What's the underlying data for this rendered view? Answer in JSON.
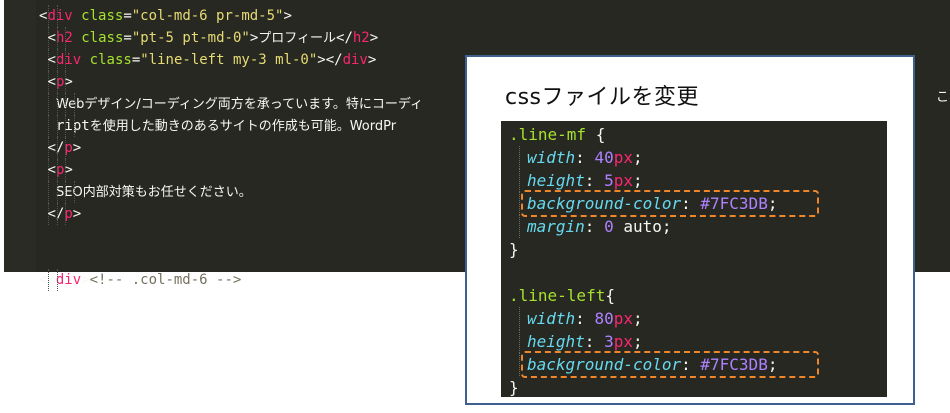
{
  "editor": {
    "lines": [
      {
        "indent": 2,
        "tokens": [
          [
            "t-text",
            "<"
          ],
          [
            "t-tag",
            "div"
          ],
          [
            "t-attr",
            " class"
          ],
          [
            "t-text",
            "="
          ],
          [
            "t-str",
            "\"col-md-6 pr-md-5\""
          ],
          [
            "t-text",
            ">"
          ]
        ]
      },
      {
        "indent": 3,
        "tokens": [
          [
            "t-text",
            "<"
          ],
          [
            "t-tag",
            "h2"
          ],
          [
            "t-attr",
            " class"
          ],
          [
            "t-text",
            "="
          ],
          [
            "t-str",
            "\"pt-5 pt-md-0\""
          ],
          [
            "t-text",
            ">"
          ],
          [
            "t-text jp",
            "プロフィール"
          ],
          [
            "t-text",
            "</"
          ],
          [
            "t-tag",
            "h2"
          ],
          [
            "t-text",
            ">"
          ]
        ]
      },
      {
        "indent": 3,
        "tokens": [
          [
            "t-text",
            "<"
          ],
          [
            "t-tag",
            "div"
          ],
          [
            "t-attr",
            " class"
          ],
          [
            "t-text",
            "="
          ],
          [
            "t-str",
            "\"line-left my-3 ml-0\""
          ],
          [
            "t-text",
            "></"
          ],
          [
            "t-tag",
            "div"
          ],
          [
            "t-text",
            ">"
          ]
        ]
      },
      {
        "indent": 3,
        "tokens": [
          [
            "t-text",
            "<"
          ],
          [
            "t-tag",
            "p"
          ],
          [
            "t-text",
            ">"
          ]
        ]
      },
      {
        "indent": 4,
        "tokens": [
          [
            "t-text jp",
            "Webデザイン/コーディング両方を承っています。特にコーディ"
          ]
        ]
      },
      {
        "indent": 4,
        "tokens": [
          [
            "t-text",
            "ript"
          ],
          [
            "t-text jp",
            "を使用した動きのあるサイトの作成も可能。WordPr"
          ]
        ]
      },
      {
        "indent": 3,
        "tokens": [
          [
            "t-text",
            "</"
          ],
          [
            "t-tag",
            "p"
          ],
          [
            "t-text",
            ">"
          ]
        ]
      },
      {
        "indent": 3,
        "tokens": [
          [
            "t-text",
            "<"
          ],
          [
            "t-tag",
            "p"
          ],
          [
            "t-text",
            ">"
          ]
        ]
      },
      {
        "indent": 4,
        "tokens": [
          [
            "t-text jp",
            "SEO内部対策もお任せください。"
          ]
        ]
      },
      {
        "indent": 3,
        "tokens": [
          [
            "t-text",
            "</"
          ],
          [
            "t-tag",
            "p"
          ],
          [
            "t-text",
            ">"
          ]
        ]
      },
      {
        "indent": 0,
        "tokens": []
      },
      {
        "indent": 0,
        "tokens": []
      },
      {
        "indent": 2,
        "tokens": [
          [
            "t-text",
            "</"
          ],
          [
            "t-tag",
            "div"
          ],
          [
            "t-text",
            ">"
          ],
          [
            "t-com",
            "<!-- .col-md-6 -->"
          ]
        ]
      }
    ],
    "overflow_right": "こと、ま"
  },
  "panel": {
    "title": "cssファイルを変更",
    "lines": [
      {
        "indent": 0,
        "tokens": [
          [
            "t-sel",
            ".line-mf"
          ],
          [
            "t-text",
            " {"
          ]
        ]
      },
      {
        "indent": 1,
        "tokens": [
          [
            "t-prop",
            "width"
          ],
          [
            "t-text",
            ": "
          ],
          [
            "t-num",
            "40"
          ],
          [
            "t-unit",
            "px"
          ],
          [
            "t-text",
            ";"
          ]
        ]
      },
      {
        "indent": 1,
        "tokens": [
          [
            "t-prop",
            "height"
          ],
          [
            "t-text",
            ": "
          ],
          [
            "t-num",
            "5"
          ],
          [
            "t-unit",
            "px"
          ],
          [
            "t-text",
            ";"
          ]
        ]
      },
      {
        "indent": 1,
        "tokens": [
          [
            "t-prop",
            "background-color"
          ],
          [
            "t-text",
            ": "
          ],
          [
            "t-color",
            "#7FC3DB"
          ],
          [
            "t-text",
            ";"
          ]
        ]
      },
      {
        "indent": 1,
        "tokens": [
          [
            "t-prop",
            "margin"
          ],
          [
            "t-text",
            ": "
          ],
          [
            "t-num",
            "0"
          ],
          [
            "t-text",
            " auto;"
          ]
        ]
      },
      {
        "indent": 0,
        "tokens": [
          [
            "t-text",
            "}"
          ]
        ]
      },
      {
        "indent": 0,
        "tokens": []
      },
      {
        "indent": 0,
        "tokens": [
          [
            "t-sel",
            ".line-left"
          ],
          [
            "t-text",
            "{"
          ]
        ]
      },
      {
        "indent": 1,
        "tokens": [
          [
            "t-prop",
            "width"
          ],
          [
            "t-text",
            ": "
          ],
          [
            "t-num",
            "80"
          ],
          [
            "t-unit",
            "px"
          ],
          [
            "t-text",
            ";"
          ]
        ]
      },
      {
        "indent": 1,
        "tokens": [
          [
            "t-prop",
            "height"
          ],
          [
            "t-text",
            ": "
          ],
          [
            "t-num",
            "3"
          ],
          [
            "t-unit",
            "px"
          ],
          [
            "t-text",
            ";"
          ]
        ]
      },
      {
        "indent": 1,
        "tokens": [
          [
            "t-prop",
            "background-color"
          ],
          [
            "t-text",
            ": "
          ],
          [
            "t-color",
            "#7FC3DB"
          ],
          [
            "t-text",
            ";"
          ]
        ]
      },
      {
        "indent": 0,
        "tokens": [
          [
            "t-text",
            "}"
          ]
        ]
      }
    ],
    "highlighted_lines": [
      3,
      10
    ]
  },
  "colors": {
    "editor_bg": "#272822",
    "highlight_border": "#f0862a",
    "panel_border": "#3f5f8f"
  }
}
